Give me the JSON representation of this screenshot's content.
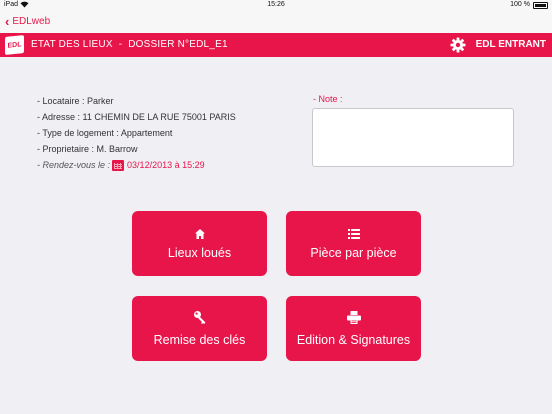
{
  "statusbar": {
    "carrier": "iPad",
    "time": "15:26",
    "battery": "100 %"
  },
  "nav": {
    "back_label": "EDLweb"
  },
  "header": {
    "logo": "EDL",
    "section": "ETAT DES LIEUX",
    "separator": "-",
    "dossier": "DOSSIER N°EDL_E1",
    "mode": "EDL ENTRANT",
    "icons": {
      "settings": "gear-icon"
    }
  },
  "info": {
    "locataire": "- Locataire : Parker",
    "adresse": "- Adresse : 11 CHEMIN DE LA RUE 75001 PARIS",
    "logement": "- Type de logement : Appartement",
    "proprietaire": "- Proprietaire : M. Barrow",
    "rdv_label": "- Rendez-vous le :",
    "rdv_date": "03/12/2013 à 15:29"
  },
  "note": {
    "label": "- Note :",
    "value": ""
  },
  "buttons": {
    "lieux": "Lieux loués",
    "piece": "Pièce par pièce",
    "cles": "Remise des clés",
    "edition": "Edition & Signatures"
  },
  "colors": {
    "accent": "#e8154b",
    "background": "#efeff4"
  }
}
